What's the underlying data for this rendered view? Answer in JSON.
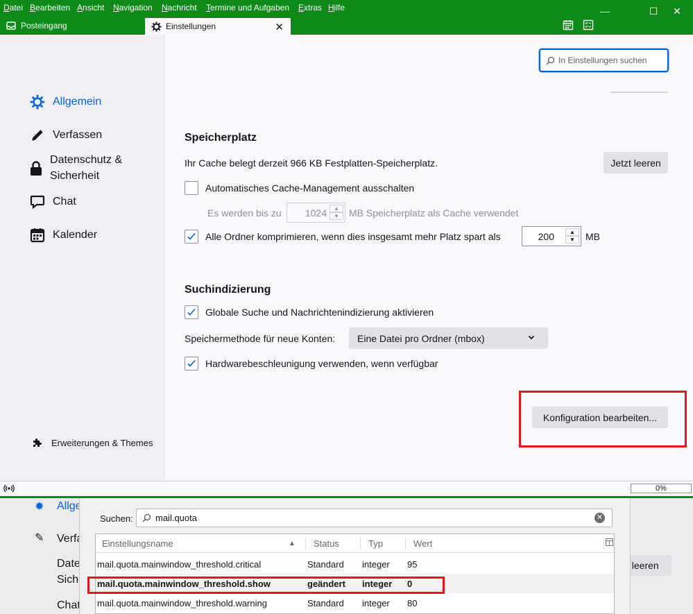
{
  "menu": [
    "Datei",
    "Bearbeiten",
    "Ansicht",
    "Navigation",
    "Nachricht",
    "Termine und Aufgaben",
    "Extras",
    "Hilfe"
  ],
  "window": {
    "minimize": "—",
    "maximize": "☐",
    "close": "✕"
  },
  "tabs": [
    {
      "label": "Posteingang",
      "icon": "inbox-icon"
    },
    {
      "label": "Einstellungen",
      "icon": "gear-icon",
      "close": "✕"
    }
  ],
  "sidebar": {
    "items": [
      {
        "label": "Allgemein",
        "icon": "gear-icon"
      },
      {
        "label": "Verfassen",
        "icon": "pencil-icon"
      },
      {
        "label": "Datenschutz & Sicherheit",
        "icon": "lock-icon"
      },
      {
        "label": "Chat",
        "icon": "chat-icon"
      },
      {
        "label": "Kalender",
        "icon": "calendar-icon"
      }
    ],
    "extensions": "Erweiterungen & Themes"
  },
  "search": {
    "placeholder": "In Einstellungen suchen"
  },
  "storage": {
    "heading": "Speicherplatz",
    "cache_text": "Ihr Cache belegt derzeit 966 KB Festplatten-Speicherplatz.",
    "clear_button": "Jetzt leeren",
    "auto_cache_label": "Automatisches Cache-Management ausschalten",
    "auto_cache_checked": false,
    "cache_limit_prefix": "Es werden bis zu",
    "cache_limit_value": "1024",
    "cache_limit_suffix": "MB Speicherplatz als Cache verwendet",
    "compact_label": "Alle Ordner komprimieren, wenn dies insgesamt mehr Platz spart als",
    "compact_checked": true,
    "compact_value": "200",
    "compact_unit": "MB"
  },
  "indexing": {
    "heading": "Suchindizierung",
    "global_search_label": "Globale Suche und Nachrichtenindizierung aktivieren",
    "global_search_checked": true,
    "store_label": "Speichermethode für neue Konten:",
    "store_value": "Eine Datei pro Ordner (mbox)",
    "hw_accel_label": "Hardwarebeschleunigung verwenden, wenn verfügbar",
    "hw_accel_checked": true
  },
  "config_button": "Konfiguration bearbeiten...",
  "status": {
    "progress": "0%"
  },
  "config_editor": {
    "search_label": "Suchen:",
    "search_value": "mail.quota",
    "columns": [
      "Einstellungsname",
      "Status",
      "Typ",
      "Wert"
    ],
    "rows": [
      {
        "name": "mail.quota.mainwindow_threshold.critical",
        "status": "Standard",
        "type": "integer",
        "value": "95"
      },
      {
        "name": "mail.quota.mainwindow_threshold.show",
        "status": "geändert",
        "type": "integer",
        "value": "0"
      },
      {
        "name": "mail.quota.mainwindow_threshold.warning",
        "status": "Standard",
        "type": "integer",
        "value": "80"
      }
    ]
  },
  "background": {
    "cat_label": "Allge",
    "verf": "Verfa",
    "dat1": "Date",
    "dat2": "Siche",
    "chat": "Chat",
    "clear": "zt leeren"
  },
  "colors": {
    "titlebar": "#0d8a18",
    "accent": "#0060df",
    "highlight": "#e8141b"
  }
}
